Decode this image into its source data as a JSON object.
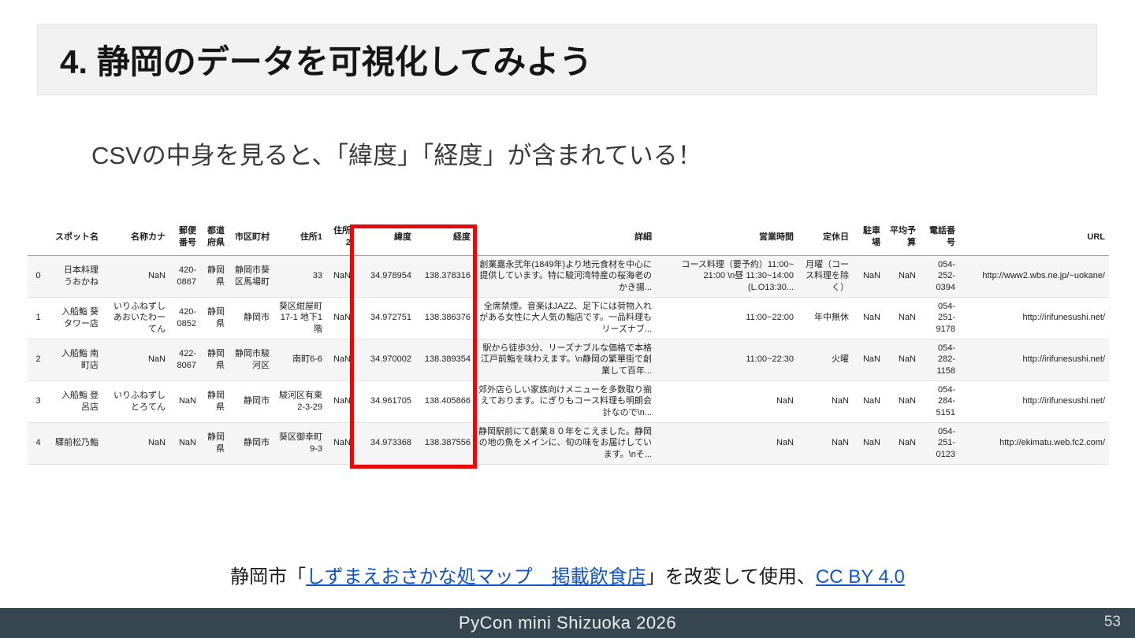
{
  "slide": {
    "title": "4. 静岡のデータを可視化してみよう",
    "subtitle": "CSVの中身を見ると、「緯度」「経度」が含まれている！",
    "attribution": {
      "prefix": "静岡市「",
      "source_link": "しずまえおさかな処マップ　掲載飲食店",
      "middle": "」を改変して使用、",
      "license_link": "CC BY 4.0"
    },
    "footer": "PyCon mini Shizuoka 2026",
    "page_number": "53"
  },
  "table": {
    "columns": [
      "",
      "スポット名",
      "名称カナ",
      "郵便番号",
      "都道府県",
      "市区町村",
      "住所1",
      "住所2",
      "緯度",
      "経度",
      "詳細",
      "営業時間",
      "定休日",
      "駐車場",
      "平均予算",
      "電話番号",
      "URL"
    ],
    "highlighted_columns": [
      "緯度",
      "経度"
    ],
    "rows": [
      [
        "0",
        "日本料理 うおかね",
        "NaN",
        "420-0867",
        "静岡県",
        "静岡市葵区馬場町",
        "33",
        "NaN",
        "34.978954",
        "138.378316",
        "創業嘉永弐年(1849年)より地元食材を中心に提供しています。特に駿河湾特産の桜海老のかき揚...",
        "コース料理（要予約）11:00~ 21:00 \\n昼 11:30~14:00 (L.O13:30...",
        "月曜（コース料理を除く）",
        "NaN",
        "NaN",
        "054-252-0394",
        "http://www2.wbs.ne.jp/~uokane/"
      ],
      [
        "1",
        "入船鮨 葵タワー店",
        "いりふねずし あおいたわーてん",
        "420-0852",
        "静岡県",
        "静岡市",
        "葵区紺屋町 17-1 地下1階",
        "NaN",
        "34.972751",
        "138.386376",
        "全席禁煙。音楽はJAZZ、足下には荷物入れがある女性に大人気の鮨店です。一品料理もリーズナブ...",
        "11:00~22:00",
        "年中無休",
        "NaN",
        "NaN",
        "054-251-9178",
        "http://irifunesushi.net/"
      ],
      [
        "2",
        "入船鮨 南町店",
        "NaN",
        "422-8067",
        "静岡県",
        "静岡市駿河区",
        "南町6-6",
        "NaN",
        "34.970002",
        "138.389354",
        "駅から徒歩3分、リーズナブルな価格で本格江戸前鮨を味わえます。\\n静岡の繁華街で創業して百年...",
        "11:00~22:30",
        "火曜",
        "NaN",
        "NaN",
        "054-282-1158",
        "http://irifunesushi.net/"
      ],
      [
        "3",
        "入船鮨 登呂店",
        "いりふねずし とろてん",
        "NaN",
        "静岡県",
        "静岡市",
        "駿河区有東 2-3-29",
        "NaN",
        "34.961705",
        "138.405866",
        "郊外店らしい家族向けメニューを多数取り揃えております。にぎりもコース料理も明朗会計なので\\n...",
        "NaN",
        "NaN",
        "NaN",
        "NaN",
        "054-284-5151",
        "http://irifunesushi.net/"
      ],
      [
        "4",
        "驛前松乃鮨",
        "NaN",
        "NaN",
        "静岡県",
        "静岡市",
        "葵区御幸町 9-3",
        "NaN",
        "34.973368",
        "138.387556",
        "静岡駅前にて創業８０年をこえました。静岡の地の魚をメインに、旬の味をお届けしています。\\nそ...",
        "NaN",
        "NaN",
        "NaN",
        "NaN",
        "054-251-0123",
        "http://ekimatu.web.fc2.com/"
      ]
    ]
  },
  "colors": {
    "accent_red": "#e60b0b",
    "link_blue": "#1155cc",
    "footer_bg": "#37474f"
  }
}
